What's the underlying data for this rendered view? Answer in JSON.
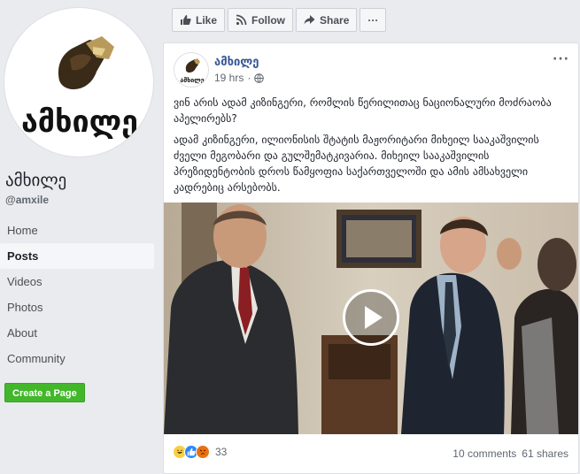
{
  "page": {
    "name": "ამხილე",
    "handle": "@amxile",
    "logo_text": "ამხილე"
  },
  "nav": {
    "items": [
      {
        "label": "Home"
      },
      {
        "label": "Posts"
      },
      {
        "label": "Videos"
      },
      {
        "label": "Photos"
      },
      {
        "label": "About"
      },
      {
        "label": "Community"
      }
    ],
    "active_index": 1
  },
  "create_page_label": "Create a Page",
  "actions": {
    "like": "Like",
    "follow": "Follow",
    "share": "Share",
    "more": "···"
  },
  "post": {
    "author": "ამხილე",
    "time": "19 hrs",
    "audience_icon": "globe-icon",
    "more": "···",
    "paragraph1": "ვინ არის ადამ კიზინგერი, რომლის წერილითაც ნაციონალური მოძრაობა აპელირებს?",
    "paragraph2": "ადამ კიზინგერი, ილიონისის შტატის მაჟორიტარი მიხეილ სააკაშვილის ძველი მეგობარი და გულშემატკივარია. მიხეილ სააკაშვილის პრეზიდენტობის დროს წამყოფია საქართველოში და ამის ამსახველი კადრებიც არსებობს.",
    "reaction_count": "33",
    "comments": "10 comments",
    "shares": "61 shares"
  },
  "colors": {
    "link": "#385898",
    "create_btn": "#42b72a",
    "background": "#e9ebee"
  }
}
